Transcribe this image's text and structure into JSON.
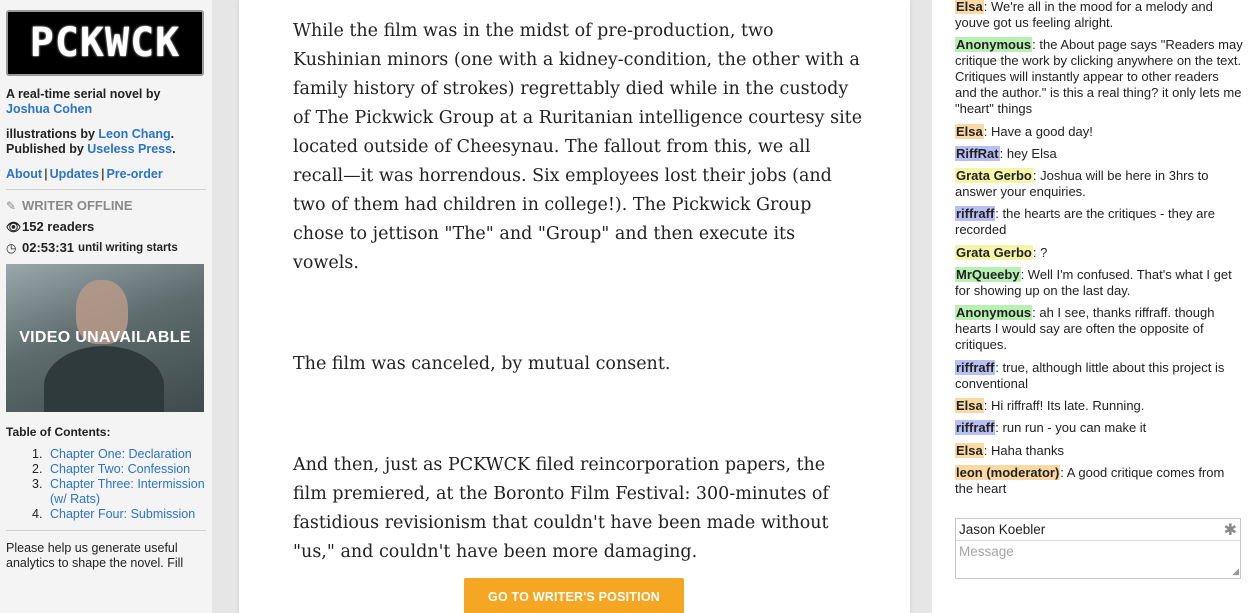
{
  "sidebar": {
    "logo_text": "PCKWCK",
    "byline_prefix": "A real-time serial novel by",
    "author": "Joshua Cohen",
    "illustrations_prefix": "illustrations by",
    "illustrator": "Leon Chang",
    "illustrator_suffix": ".",
    "published_prefix": "Published by",
    "publisher": "Useless Press",
    "publisher_suffix": ".",
    "links": [
      "About",
      "Updates",
      "Pre-order"
    ],
    "writer_status": "WRITER OFFLINE",
    "readers": "152 readers",
    "countdown": "02:53:31",
    "countdown_suffix": "until writing starts",
    "video_label": "VIDEO UNAVAILABLE",
    "toc_title": "Table of Contents:",
    "toc": [
      {
        "num": "1.",
        "label": "Chapter One: Declaration"
      },
      {
        "num": "2.",
        "label": "Chapter Two: Confession"
      },
      {
        "num": "3.",
        "label": "Chapter Three: Intermission (w/ Rats)"
      },
      {
        "num": "4.",
        "label": "Chapter Four: Submission"
      }
    ],
    "help_text": "Please help us generate useful analytics to shape the novel. Fill"
  },
  "main": {
    "paragraphs": [
      "While the film was in the midst of pre-production, two Kushinian minors (one with a kidney-condition, the other with a family history of strokes) regrettably died while in the custody of The Pickwick Group at a Ruritanian intelligence courtesy site located outside of Cheesynau. The fallout from this, we all recall—it was horrendous. Six employees lost their jobs (and two of them had children in college!). The Pickwick Group chose to jettison \"The\" and \"Group\" and then execute its vowels.",
      "The film was canceled, by mutual consent.",
      "And then, just as PCKWCK filed reincorporation papers, the film premiered, at the Boronto Film Festival: 300-minutes of fastidious revisionism that couldn't have been made without \"us,\" and couldn't have been more damaging."
    ],
    "goto_button": "GO TO WRITER'S POSITION"
  },
  "chat": {
    "messages": [
      {
        "nick": "Elsa",
        "color": "#fbd9a5",
        "text": ": We're all in the mood for a melody and youve got us feeling alright."
      },
      {
        "nick": "Anonymous",
        "color": "#b7f0b2",
        "text": ": the About page says \"Readers may critique the work by clicking anywhere on the text. Critiques will instantly appear to other readers and the author.\" is this a real thing? it only lets me \"heart\" things"
      },
      {
        "nick": "Elsa",
        "color": "#fbd9a5",
        "text": ": Have a good day!"
      },
      {
        "nick": "RiffRat",
        "color": "#b9bff3",
        "text": ": hey Elsa"
      },
      {
        "nick": "Grata Gerbo",
        "color": "#f5f5a8",
        "text": ": Joshua will be here in 3hrs to answer your enquiries."
      },
      {
        "nick": "riffraff",
        "color": "#b9bff3",
        "text": ": the hearts are the critiques - they are recorded"
      },
      {
        "nick": "Grata Gerbo",
        "color": "#f5f5a8",
        "text": ": ?"
      },
      {
        "nick": "MrQueeby",
        "color": "#b7f0b2",
        "text": ": Well I'm confused. That's what I get for showing up on the last day."
      },
      {
        "nick": "Anonymous",
        "color": "#b7f0b2",
        "text": ": ah I see, thanks riffraff. though hearts I would say are often the opposite of critiques."
      },
      {
        "nick": "riffraff",
        "color": "#b9bff3",
        "text": ": true, although little about this project is conventional"
      },
      {
        "nick": "Elsa",
        "color": "#fbd9a5",
        "text": ": Hi riffraff! Its late. Running."
      },
      {
        "nick": "riffraff",
        "color": "#b9bff3",
        "text": ": run run - you can make it"
      },
      {
        "nick": "Elsa",
        "color": "#fbd9a5",
        "text": ": Haha thanks"
      },
      {
        "nick": "leon (moderator)",
        "color": "#fbd9a5",
        "text": ": A good critique comes from the heart"
      }
    ],
    "name_value": "Jason Koebler",
    "message_placeholder": "Message"
  }
}
